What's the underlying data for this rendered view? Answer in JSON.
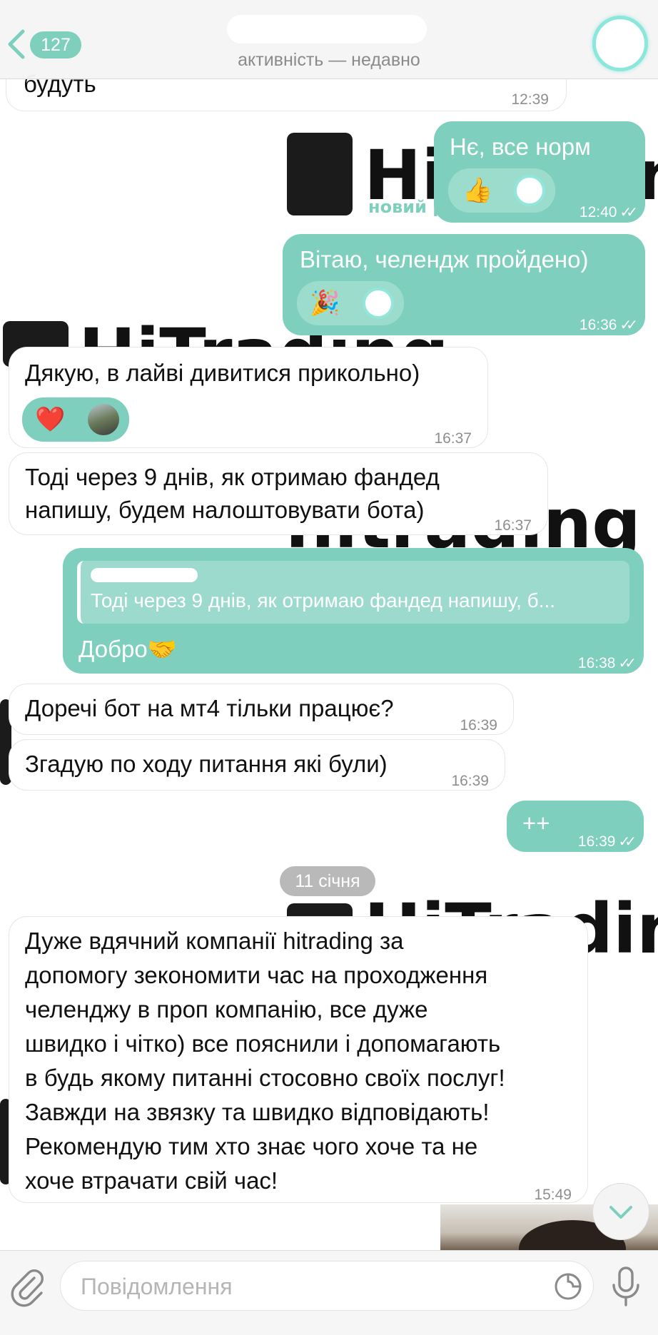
{
  "header": {
    "unread_count": "127",
    "status": "активність — недавно"
  },
  "wallpaper": {
    "brand": "HiTrading",
    "tagline": "новий р",
    "brand_lower": "hitrading"
  },
  "messages": [
    {
      "id": "m0",
      "direction": "in",
      "text": "будуть",
      "time": "12:39"
    },
    {
      "id": "m1",
      "direction": "out",
      "text": "Нє, все норм",
      "time": "12:40",
      "reaction": "👍"
    },
    {
      "id": "m2",
      "direction": "out",
      "text": "Вітаю, челендж пройдено)",
      "time": "16:36",
      "reaction": "🎉"
    },
    {
      "id": "m3",
      "direction": "in",
      "text": "Дякую, в лайві дивитися прикольно)",
      "time": "16:37",
      "reaction": "❤️"
    },
    {
      "id": "m4",
      "direction": "in",
      "lines": [
        "Тоді через 9 днів, як отримаю фандед",
        "напишу, будем налоштовувати бота)"
      ],
      "time": "16:37"
    },
    {
      "id": "m5",
      "direction": "out",
      "reply_to": "Тоді через 9 днів, як отримаю фандед напишу, б...",
      "text": "Добро🤝",
      "time": "16:38"
    },
    {
      "id": "m6",
      "direction": "in",
      "text": "Доречі бот на мт4 тільки працює?",
      "time": "16:39"
    },
    {
      "id": "m7",
      "direction": "in",
      "text": "Згадую по ходу питання які були)",
      "time": "16:39"
    },
    {
      "id": "m8",
      "direction": "out",
      "text": "++",
      "time": "16:39"
    },
    {
      "id": "m9",
      "direction": "in",
      "lines": [
        "Дуже вдячний компанії hitrading за",
        "допомогу зекономити час на проходження",
        "челенджу в проп компанію, все дуже",
        "швидко і чітко) все пояснили і допомагають",
        "в будь якому питанні стосовно своїх послуг!",
        "Завжди на звязку та швидко відповідають!",
        "Рекомендую тим хто знає чого хоче та не",
        "хоче втрачати свій час!"
      ],
      "time": "15:49"
    }
  ],
  "date_separator": "11 січня",
  "composer": {
    "placeholder": "Повідомлення"
  },
  "colors": {
    "accent": "#7ecfbd",
    "badge": "#7fcfbd"
  }
}
